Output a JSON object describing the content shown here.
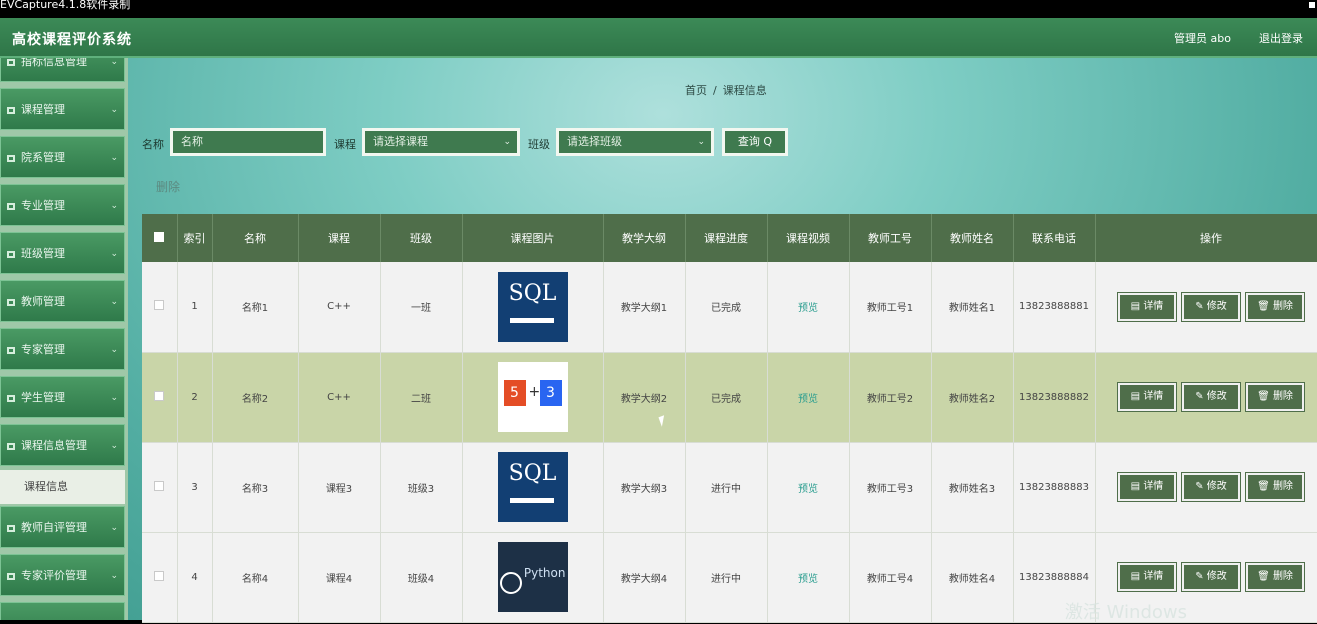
{
  "capture_title": "EVCapture4.1.8软件录制",
  "app": {
    "title": "高校课程评价系统",
    "user": "管理员 abo",
    "logout": "退出登录"
  },
  "sidebar": {
    "items": [
      {
        "label": "指标信息管理"
      },
      {
        "label": "课程管理"
      },
      {
        "label": "院系管理"
      },
      {
        "label": "专业管理"
      },
      {
        "label": "班级管理"
      },
      {
        "label": "教师管理"
      },
      {
        "label": "专家管理"
      },
      {
        "label": "学生管理"
      },
      {
        "label": "课程信息管理"
      },
      {
        "label": "教师自评管理"
      },
      {
        "label": "专家评价管理"
      }
    ],
    "sub_item": "课程信息"
  },
  "breadcrumb": {
    "home": "首页",
    "sep": "/",
    "current": "课程信息"
  },
  "search": {
    "name_label": "名称",
    "name_placeholder": "名称",
    "course_label": "课程",
    "course_placeholder": "请选择课程",
    "class_label": "班级",
    "class_placeholder": "请选择班级",
    "query_label": "查询 Q"
  },
  "delete_label": "删除",
  "table": {
    "headers": [
      "索引",
      "名称",
      "课程",
      "班级",
      "课程图片",
      "教学大纲",
      "课程进度",
      "课程视频",
      "教师工号",
      "教师姓名",
      "联系电话",
      "操作"
    ],
    "rows": [
      {
        "index": "1",
        "name": "名称1",
        "course": "C++",
        "class": "一班",
        "image": "sql",
        "syllabus": "教学大纲1",
        "progress": "已完成",
        "video": "预览",
        "teacher_no": "教师工号1",
        "teacher_name": "教师姓名1",
        "phone": "13823888881"
      },
      {
        "index": "2",
        "name": "名称2",
        "course": "C++",
        "class": "二班",
        "image": "html-css",
        "syllabus": "教学大纲2",
        "progress": "已完成",
        "video": "预览",
        "teacher_no": "教师工号2",
        "teacher_name": "教师姓名2",
        "phone": "13823888882"
      },
      {
        "index": "3",
        "name": "名称3",
        "course": "课程3",
        "class": "班级3",
        "image": "sql",
        "syllabus": "教学大纲3",
        "progress": "进行中",
        "video": "预览",
        "teacher_no": "教师工号3",
        "teacher_name": "教师姓名3",
        "phone": "13823888883"
      },
      {
        "index": "4",
        "name": "名称4",
        "course": "课程4",
        "class": "班级4",
        "image": "python",
        "syllabus": "教学大纲4",
        "progress": "进行中",
        "video": "预览",
        "teacher_no": "教师工号4",
        "teacher_name": "教师姓名4",
        "phone": "13823888884"
      }
    ],
    "actions": {
      "detail": "详情",
      "edit": "修改",
      "delete": "删除"
    }
  },
  "images": {
    "sql_text": "SQL",
    "python_text": "Python"
  },
  "watermark": "激活 Windows"
}
